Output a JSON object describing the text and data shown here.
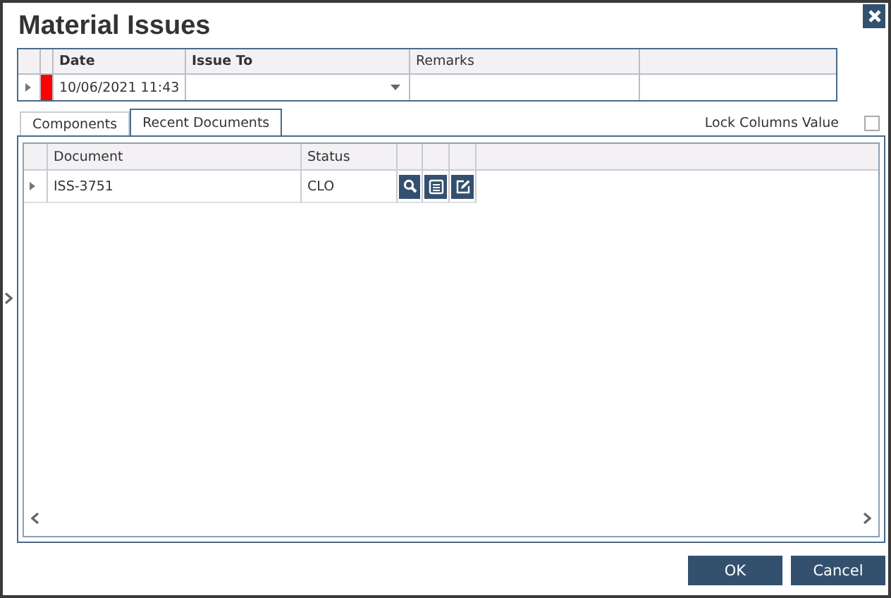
{
  "window": {
    "title": "Material Issues"
  },
  "header_grid": {
    "columns": [
      "Date",
      "Issue To",
      "Remarks"
    ],
    "rows": [
      {
        "date": "10/06/2021 11:43",
        "issue_to": "",
        "remarks": ""
      }
    ]
  },
  "tabs": [
    {
      "label": "Components",
      "selected": false
    },
    {
      "label": "Recent Documents",
      "selected": true
    }
  ],
  "lock_columns": {
    "label": "Lock Columns Value",
    "checked": false
  },
  "documents_grid": {
    "columns": [
      "Document",
      "Status"
    ],
    "rows": [
      {
        "document": "ISS-3751",
        "status": "CLO"
      }
    ]
  },
  "buttons": [
    "OK",
    "Cancel"
  ]
}
